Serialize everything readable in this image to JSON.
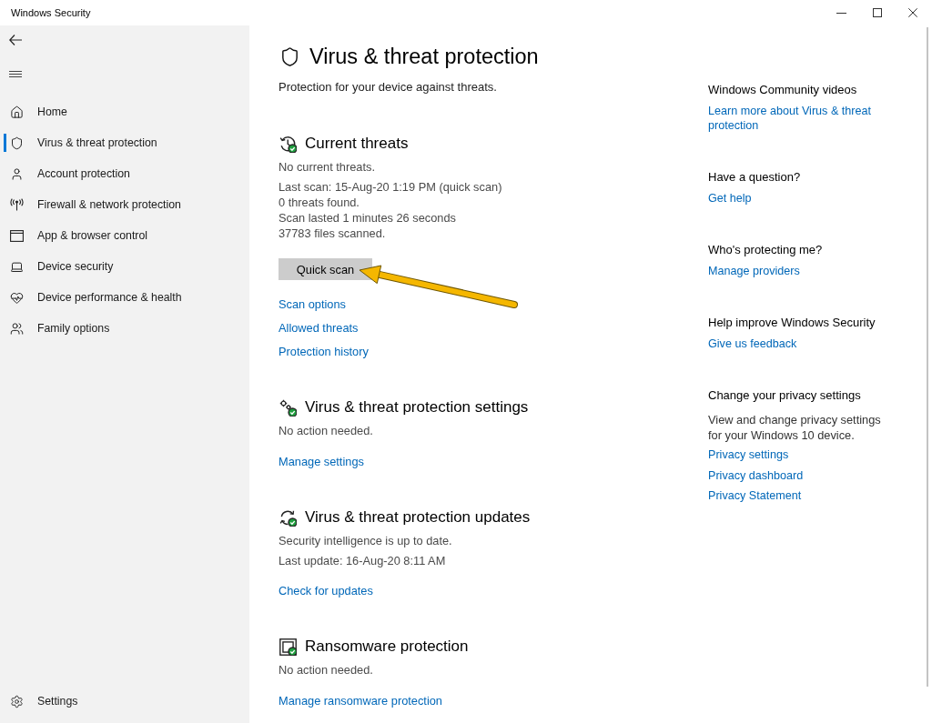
{
  "window": {
    "title": "Windows Security"
  },
  "sidebar": {
    "items": [
      {
        "label": "Home",
        "selected": false
      },
      {
        "label": "Virus & threat protection",
        "selected": true
      },
      {
        "label": "Account protection",
        "selected": false
      },
      {
        "label": "Firewall & network protection",
        "selected": false
      },
      {
        "label": "App & browser control",
        "selected": false
      },
      {
        "label": "Device security",
        "selected": false
      },
      {
        "label": "Device performance & health",
        "selected": false
      },
      {
        "label": "Family options",
        "selected": false
      }
    ],
    "footer": {
      "label": "Settings"
    }
  },
  "page": {
    "title": "Virus & threat protection",
    "subtitle": "Protection for your device against threats."
  },
  "sections": [
    {
      "heading": "Current threats",
      "ok": true,
      "status": "No current threats.",
      "details": [
        "Last scan: 15-Aug-20 1:19 PM (quick scan)",
        "0 threats found.",
        "Scan lasted 1 minutes 26 seconds",
        "37783 files scanned."
      ],
      "button": {
        "label": "Quick scan",
        "pointer_arrow": true
      },
      "links": [
        "Scan options",
        "Allowed threats",
        "Protection history"
      ]
    },
    {
      "heading": "Virus & threat protection settings",
      "ok": true,
      "status": "No action needed.",
      "links": [
        "Manage settings"
      ]
    },
    {
      "heading": "Virus & threat protection updates",
      "ok": true,
      "status": "Security intelligence is up to date.",
      "details": [
        "Last update: 16-Aug-20 8:11 AM"
      ],
      "links": [
        "Check for updates"
      ]
    },
    {
      "heading": "Ransomware protection",
      "ok": true,
      "status": "No action needed.",
      "links": [
        "Manage ransomware protection"
      ]
    }
  ],
  "aside": [
    {
      "heading": "Windows Community videos",
      "links": [
        "Learn more about Virus & threat protection"
      ]
    },
    {
      "heading": "Have a question?",
      "links": [
        "Get help"
      ]
    },
    {
      "heading": "Who's protecting me?",
      "links": [
        "Manage providers"
      ]
    },
    {
      "heading": "Help improve Windows Security",
      "links": [
        "Give us feedback"
      ]
    },
    {
      "heading": "Change your privacy settings",
      "text": "View and change privacy settings for your Windows 10 device.",
      "links": [
        "Privacy settings",
        "Privacy dashboard",
        "Privacy Statement"
      ]
    }
  ]
}
